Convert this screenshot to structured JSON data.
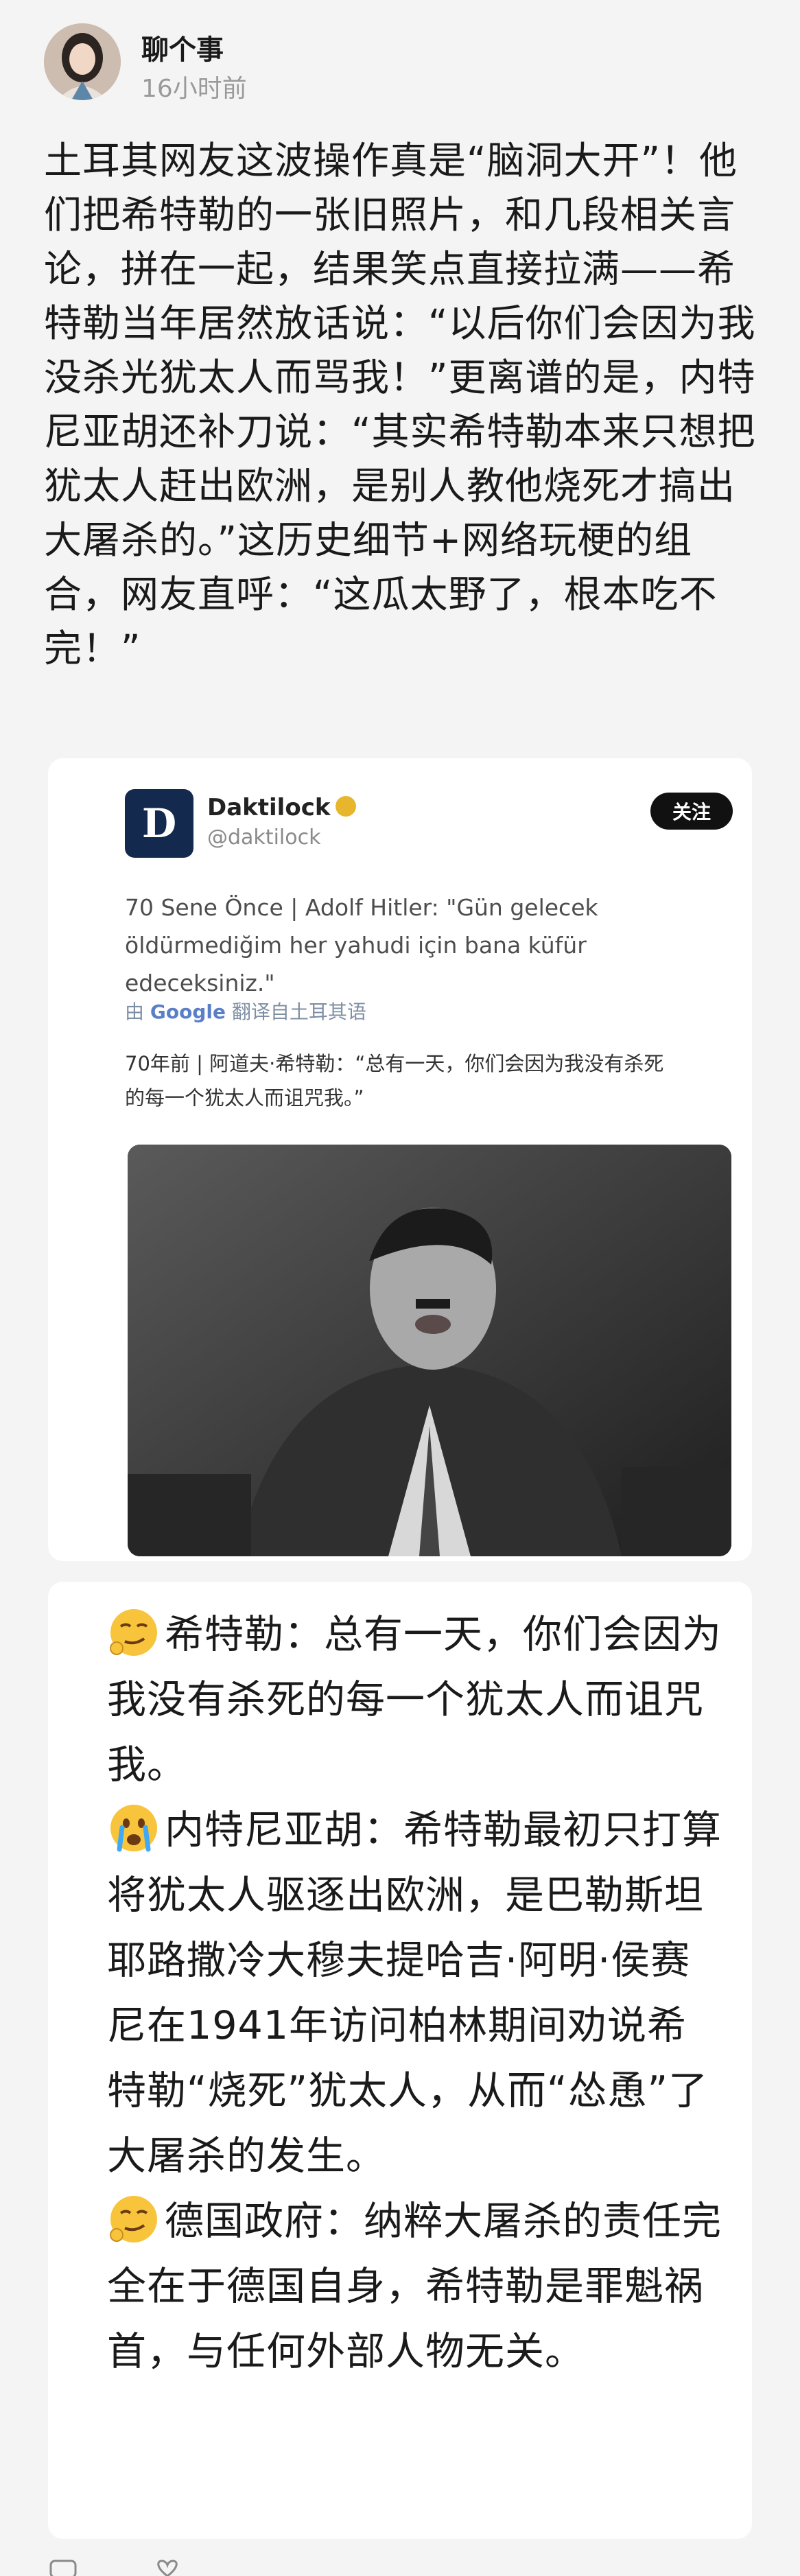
{
  "post": {
    "author": "聊个事",
    "time": "16小时前",
    "text": "土耳其网友这波操作真是“脑洞大开”！他\n们把希特勒的一张旧照片，和几段相关言\n论，拼在一起，结果笑点直接拉满——希\n特勒当年居然放话说：“以后你们会因为我\n没杀光犹太人而骂我！”更离谱的是，内特\n尼亚胡还补刀说：“其实希特勒本来只想把\n犹太人赶出欧洲，是别人教他烧死才搞出\n大屠杀的。”这历史细节+网络玩梗的组\n合，网友直呼：“这瓜太野了，根本吃不\n完！”"
  },
  "tweet": {
    "account_logo_letter": "D",
    "name": "Daktilock",
    "handle": "@daktilock",
    "follow_label": "关注",
    "text": "70 Sene Önce | Adolf Hitler: \"Gün gelecek\nöldürmediğim her yahudi için bana küfür edeceksiniz.\"",
    "translate_prefix": "由",
    "translate_brand": "Google",
    "translate_suffix": "翻译自土耳其语",
    "translated_text": "70年前 | 阿道夫·希特勒：“总有一天，你们会因为我没有杀死\n的每一个犹太人而诅咒我。”"
  },
  "quotes": [
    {
      "emoji": "smirk-emoji",
      "text": "希特勒：总有一天，你们会因为我没有杀死的每一个犹太人而诅咒我。"
    },
    {
      "emoji": "crying-emoji",
      "text": "内特尼亚胡：希特勒最初只打算将犹太人驱逐出欧洲，是巴勒斯坦耶路撒冷大穆夫提哈吉·阿明·侯赛尼在1941年访问柏林期间劝说希特勒“烧死”犹太人，从而“怂恿”了大屠杀的发生。"
    },
    {
      "emoji": "smirk-emoji",
      "text": "德国政府：纳粹大屠杀的责任完全在于德国自身，希特勒是罪魁祸首，与任何外部人物无关。"
    }
  ],
  "colors": {
    "background": "#f4f4f4",
    "card": "#ffffff",
    "logo_navy": "#14294e",
    "follow_button": "#111111",
    "muted_text": "#9a9a9a"
  }
}
